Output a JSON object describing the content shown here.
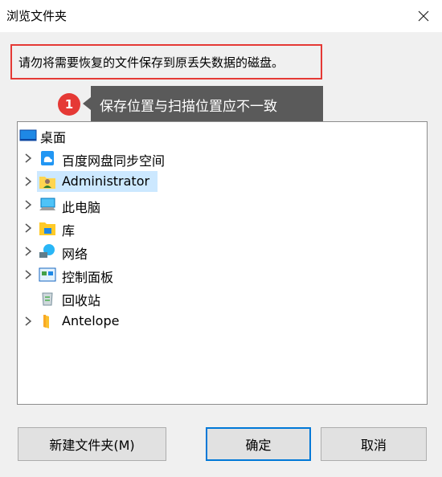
{
  "window": {
    "title": "浏览文件夹"
  },
  "warning": {
    "text": "请勿将需要恢复的文件保存到原丢失数据的磁盘。"
  },
  "annotation": {
    "step": "1",
    "text": "保存位置与扫描位置应不一致"
  },
  "tree": {
    "items": [
      {
        "label": "桌面",
        "icon": "desktop-icon"
      },
      {
        "label": "百度网盘同步空间",
        "icon": "cloud-sync-icon"
      },
      {
        "label": "Administrator",
        "icon": "user-folder-icon"
      },
      {
        "label": "此电脑",
        "icon": "computer-icon"
      },
      {
        "label": "库",
        "icon": "library-icon"
      },
      {
        "label": "网络",
        "icon": "network-icon"
      },
      {
        "label": "控制面板",
        "icon": "control-panel-icon"
      },
      {
        "label": "回收站",
        "icon": "recycle-bin-icon"
      },
      {
        "label": "Antelope",
        "icon": "folder-icon"
      }
    ]
  },
  "buttons": {
    "new_folder": "新建文件夹(M)",
    "ok": "确定",
    "cancel": "取消"
  },
  "colors": {
    "highlight": "#e53935",
    "selection": "#cce8ff",
    "tooltip_bg": "#5a5a5a",
    "focus": "#0078d7"
  }
}
